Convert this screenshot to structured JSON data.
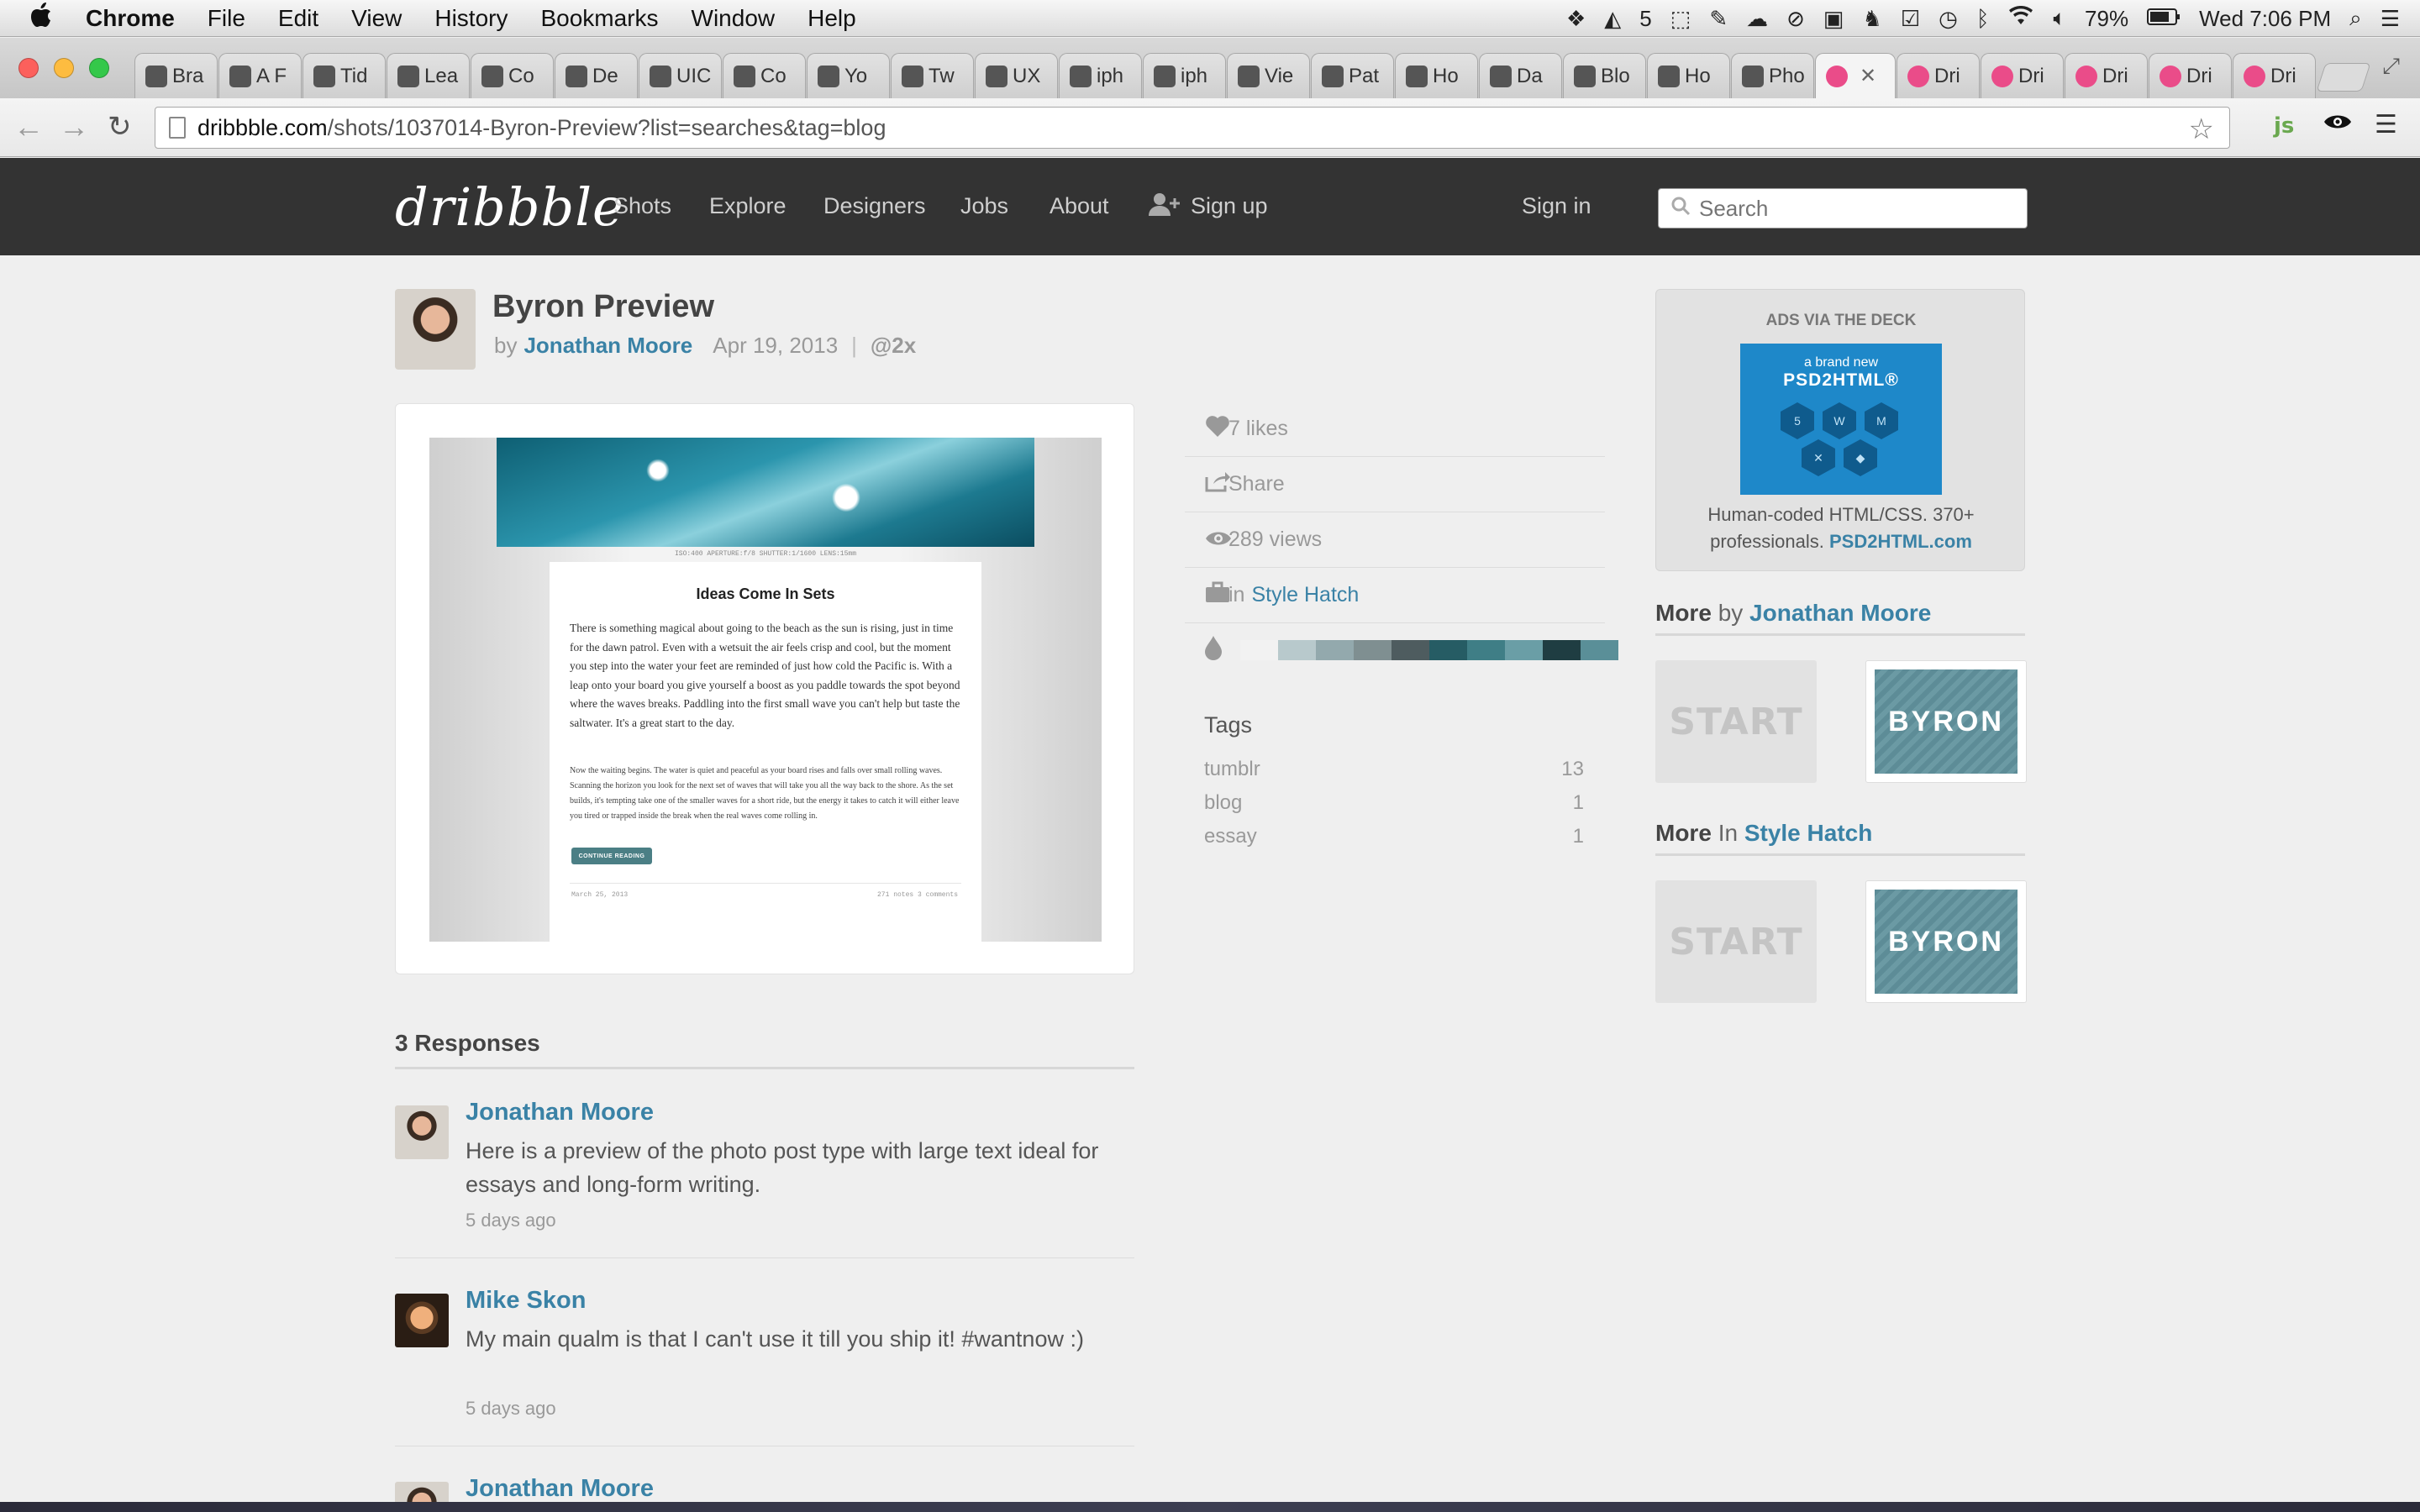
{
  "menubar": {
    "apple": "",
    "items": [
      "Chrome",
      "File",
      "Edit",
      "View",
      "History",
      "Bookmarks",
      "Window",
      "Help"
    ],
    "battery": "79%",
    "clock": "Wed 7:06 PM",
    "adobe_count": "5"
  },
  "tabs": [
    {
      "label": "Bra"
    },
    {
      "label": "A F"
    },
    {
      "label": "Tid"
    },
    {
      "label": "Lea"
    },
    {
      "label": "Co"
    },
    {
      "label": "De"
    },
    {
      "label": "UIC"
    },
    {
      "label": "Co"
    },
    {
      "label": "Yo"
    },
    {
      "label": "Tw"
    },
    {
      "label": "UX"
    },
    {
      "label": "iph"
    },
    {
      "label": "iph"
    },
    {
      "label": "Vie"
    },
    {
      "label": "Pat"
    },
    {
      "label": "Ho"
    },
    {
      "label": "Da"
    },
    {
      "label": "Blo"
    },
    {
      "label": "Ho"
    },
    {
      "label": "Pho"
    },
    {
      "label": ""
    },
    {
      "label": "Dri"
    },
    {
      "label": "Dri"
    },
    {
      "label": "Dri"
    },
    {
      "label": "Dri"
    },
    {
      "label": "Dri"
    }
  ],
  "address_bar": {
    "host": "dribbble.com",
    "path": "/shots/1037014-Byron-Preview?list=searches&tag=blog"
  },
  "site": {
    "logo": "dribbble",
    "nav": {
      "shots": "Shots",
      "explore": "Explore",
      "designers": "Designers",
      "jobs": "Jobs",
      "about": "About",
      "signup": "Sign up",
      "signin": "Sign in"
    },
    "search_placeholder": "Search"
  },
  "shot": {
    "title": "Byron Preview",
    "by": "by",
    "author": "Jonathan Moore",
    "date": "Apr 19, 2013",
    "hd": "@2x",
    "preview": {
      "exif": "ISO:400   APERTURE:f/8   SHUTTER:1/1600   LENS:15mm",
      "post_title": "Ideas Come In Sets",
      "p1": "There is something magical about going to the beach as the sun is rising, just in time for the dawn patrol. Even with a wetsuit the air feels crisp and cool, but the moment you step into the water your feet are reminded of just how cold the Pacific is. With a leap onto your board you give yourself a boost as you paddle towards the spot beyond where the waves breaks. Paddling into the first small wave you can't help but taste the saltwater. It's a great start to the day.",
      "p2": "Now the waiting begins. The water is quiet and peaceful as your board rises and falls over small rolling waves. Scanning the horizon you look for the next set of waves that will take you all the way back to the shore. As the set builds, it's tempting take one of the smaller waves for a short ride, but the energy it takes to catch it will either leave you tired or trapped inside the break when the real waves come rolling in.",
      "continue": "CONTINUE READING",
      "post_date": "March 25, 2013",
      "notes": "271 notes   3 comments"
    }
  },
  "stats": {
    "likes": "7 likes",
    "share": "Share",
    "views": "289 views",
    "in_label": "in",
    "team": "Style Hatch"
  },
  "palette": [
    "#f2f2f2",
    "#b8c9cc",
    "#93a9ad",
    "#7f8f91",
    "#4e5c5f",
    "#265c64",
    "#3f7e86",
    "#6a9ea6",
    "#1f3d42",
    "#5a8f98"
  ],
  "tags": {
    "heading": "Tags",
    "items": [
      {
        "name": "tumblr",
        "count": "13"
      },
      {
        "name": "blog",
        "count": "1"
      },
      {
        "name": "essay",
        "count": "1"
      }
    ]
  },
  "ad": {
    "heading": "ADS VIA THE DECK",
    "tagline": "a brand new",
    "brand": "PSD2HTML®",
    "text": "Human-coded HTML/CSS. 370+ professionals.",
    "link": "PSD2HTML.com"
  },
  "more_by": {
    "more": "More",
    "by": "by",
    "name": "Jonathan Moore"
  },
  "more_in": {
    "more": "More",
    "in": "In",
    "name": "Style Hatch"
  },
  "thumbs": {
    "start": "START",
    "byron": "BYRON"
  },
  "responses": {
    "heading": "3 Responses",
    "items": [
      {
        "name": "Jonathan Moore",
        "text": "Here is a preview of the photo post type with large text ideal for essays and long-form writing.",
        "time": "5 days ago"
      },
      {
        "name": "Mike Skon",
        "text": "My main qualm is that I can't use it till you ship it! #wantnow :)",
        "time": "5 days ago"
      },
      {
        "name": "Jonathan Moore"
      }
    ]
  }
}
